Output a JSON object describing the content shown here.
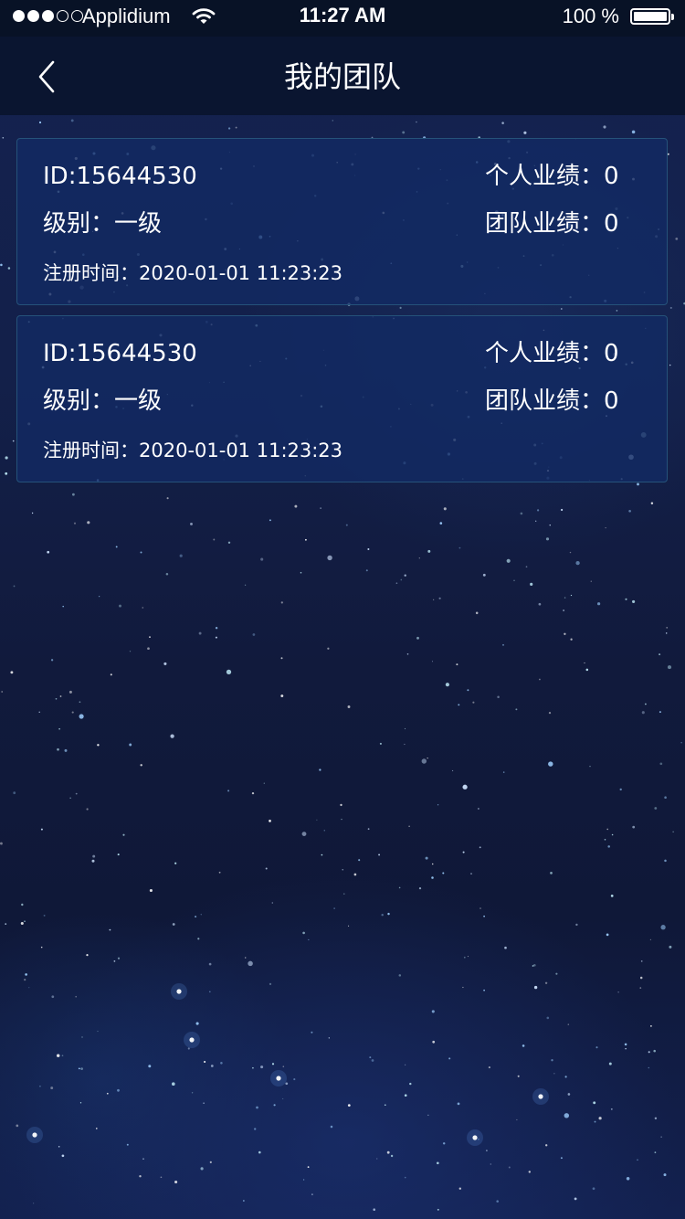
{
  "status_bar": {
    "carrier": "Applidium",
    "time": "11:27 AM",
    "battery_text": "100 %",
    "signal_strength": 3,
    "battery_level": 1.0
  },
  "nav": {
    "title": "我的团队",
    "back_icon": "chevron-left-icon"
  },
  "members": [
    {
      "id_text": "ID:15644530",
      "level_text": "级别：一级",
      "registered_text": "注册时间：2020-01-01 11:23:23",
      "personal_perf_text": "个人业绩：0",
      "team_perf_text": "团队业绩：0"
    },
    {
      "id_text": "ID:15644530",
      "level_text": "级别：一级",
      "registered_text": "注册时间：2020-01-01 11:23:23",
      "personal_perf_text": "个人业绩：0",
      "team_perf_text": "团队业绩：0"
    }
  ],
  "colors": {
    "status_bar_bg": "#081226",
    "nav_bar_bg": "#0a1530",
    "card_bg": "#13285f",
    "card_border": "#25527a",
    "page_bg": "#111a3c",
    "text": "#ffffff"
  }
}
